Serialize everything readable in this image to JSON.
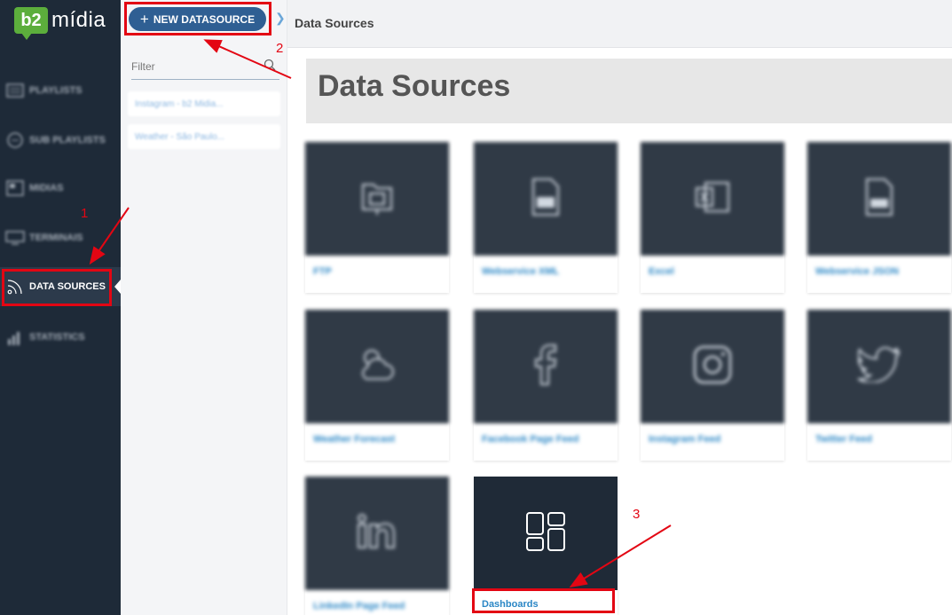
{
  "app": {
    "logo_badge": "b2",
    "logo_text": "mídia"
  },
  "sidebar": {
    "items": [
      {
        "label": "PLAYLISTS",
        "icon": "playlist-icon",
        "blurred": true
      },
      {
        "label": "SUB PLAYLISTS",
        "icon": "sub-playlist-icon",
        "blurred": true
      },
      {
        "label": "MIDIAS",
        "icon": "media-icon",
        "blurred": true
      },
      {
        "label": "TERMINAIS",
        "icon": "monitor-icon",
        "blurred": true
      },
      {
        "label": "DATA SOURCES",
        "icon": "rss-icon",
        "active": true
      },
      {
        "label": "STATISTICS",
        "icon": "bar-chart-icon",
        "blurred": true
      }
    ]
  },
  "panel": {
    "new_button_label": "NEW DATASOURCE",
    "filter_placeholder": "Filter",
    "list": [
      "Instagram - b2 Midia...",
      "Weather - São Paulo..."
    ]
  },
  "header": {
    "breadcrumb": "Data Sources"
  },
  "main": {
    "title": "Data Sources",
    "cards": [
      {
        "label": "FTP",
        "icon": "folder-icon",
        "blurred": true
      },
      {
        "label": "Webservice XML",
        "icon": "xml-file-icon",
        "blurred": true
      },
      {
        "label": "Excel",
        "icon": "excel-icon",
        "blurred": true
      },
      {
        "label": "Webservice JSON",
        "icon": "json-file-icon",
        "blurred": true
      },
      {
        "label": "Weather Forecast",
        "icon": "weather-icon",
        "blurred": true
      },
      {
        "label": "Facebook Page Feed",
        "icon": "facebook-icon",
        "blurred": true
      },
      {
        "label": "Instagram Feed",
        "icon": "instagram-icon",
        "blurred": true
      },
      {
        "label": "Twitter Feed",
        "icon": "twitter-icon",
        "blurred": true
      },
      {
        "label": "LinkedIn Page Feed",
        "icon": "linkedin-icon",
        "blurred": true
      },
      {
        "label": "Dashboards",
        "icon": "dashboard-icon",
        "blurred": false
      }
    ]
  },
  "annotations": {
    "one": "1",
    "two": "2",
    "three": "3"
  },
  "colors": {
    "sidebar_bg": "#1e2a38",
    "accent_blue": "#2f5f93",
    "annotation_red": "#e30613",
    "link_blue": "#2a86c5"
  }
}
